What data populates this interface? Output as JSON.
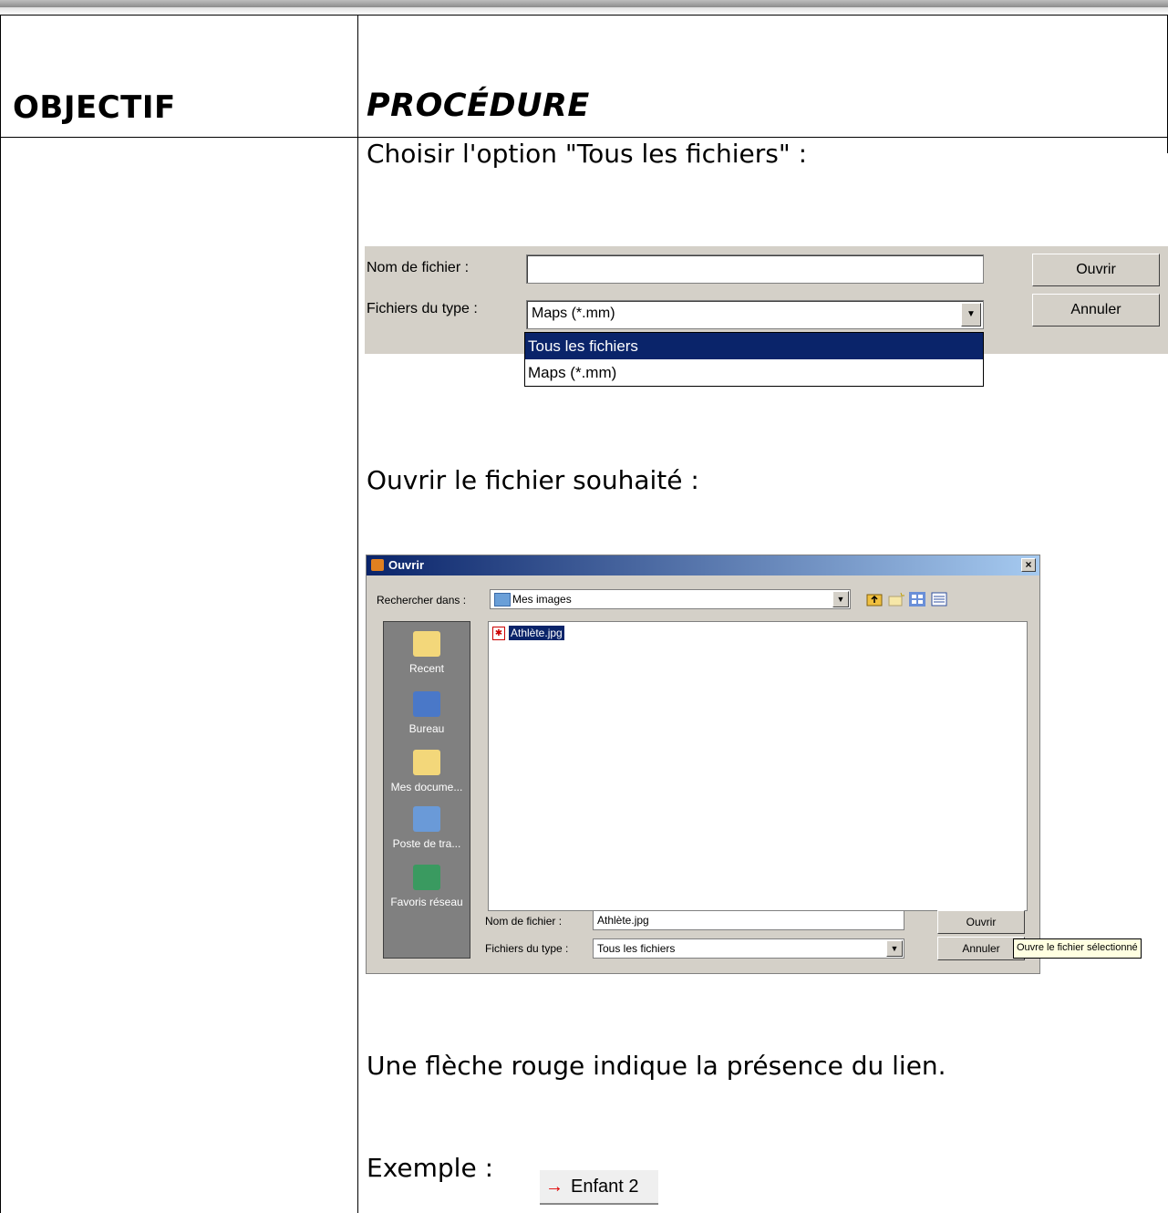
{
  "headers": {
    "objectif": "OBJECTIF",
    "procedure": "PROCÉDURE"
  },
  "steps": {
    "step1": "Choisir l'option \"Tous les fichiers\" :",
    "step2": "Ouvrir le fichier souhaité :",
    "step3": "Une flèche rouge indique la présence du lien.",
    "step4": "Exemple :"
  },
  "type_snippet": {
    "filename_label": "Nom de fichier :",
    "filename_value": "",
    "type_label": "Fichiers du type :",
    "type_value": "Maps (*.mm)",
    "open_button": "Ouvrir",
    "cancel_button": "Annuler",
    "options": [
      "Tous les fichiers",
      "Maps (*.mm)"
    ],
    "selected_option": "Tous les fichiers"
  },
  "open_dialog": {
    "title": "Ouvrir",
    "lookin_label": "Rechercher dans :",
    "lookin_value": "Mes images",
    "places": [
      "Recent",
      "Bureau",
      "Mes docume...",
      "Poste de tra...",
      "Favoris réseau"
    ],
    "files": [
      "Athlète.jpg"
    ],
    "filename_label": "Nom de fichier :",
    "filename_value": "Athlète.jpg",
    "type_label": "Fichiers du type :",
    "type_value": "Tous les fichiers",
    "open_button": "Ouvrir",
    "cancel_button": "Annuler",
    "tooltip": "Ouvre le fichier sélectionné"
  },
  "example": {
    "arrow": "→",
    "label": "Enfant 2",
    "arrow_color": "#e00000"
  }
}
